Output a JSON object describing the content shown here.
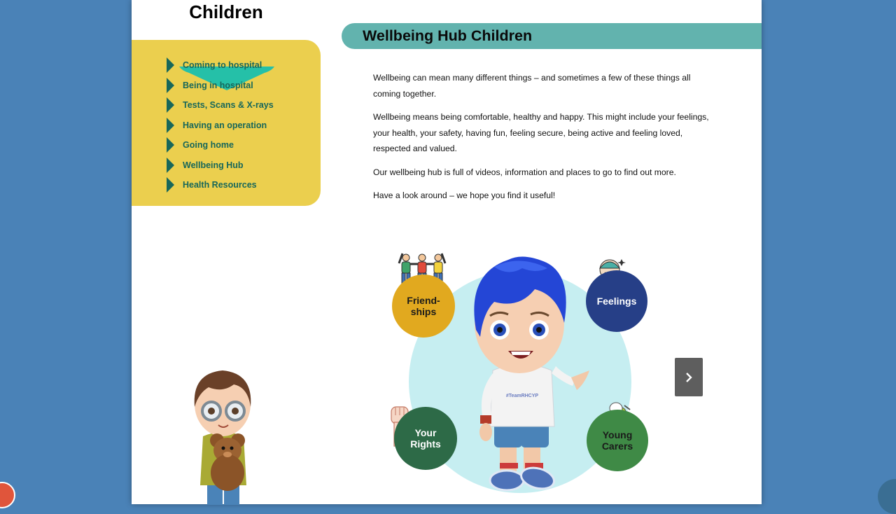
{
  "nav": {
    "heading": "Children",
    "items": [
      {
        "label": "Coming to hospital"
      },
      {
        "label": "Being in hospital"
      },
      {
        "label": "Tests, Scans & X-rays"
      },
      {
        "label": "Having an operation"
      },
      {
        "label": "Going home"
      },
      {
        "label": "Wellbeing Hub"
      },
      {
        "label": "Health Resources"
      }
    ]
  },
  "main": {
    "title": "Wellbeing Hub Children",
    "paragraphs": [
      "Wellbeing can mean many different things – and sometimes a few of these things all coming together.",
      "Wellbeing means being comfortable, healthy and happy.  This might include your feelings, your health, your safety, having fun, feeling secure, being active and feeling loved, respected and valued.",
      "Our wellbeing hub is full of videos, information and places to go to find out more.",
      "Have a look around – we hope you find it useful!"
    ]
  },
  "wheel": {
    "topics": [
      {
        "line1": "Friend-",
        "line2": "ships"
      },
      {
        "line1": "Feelings",
        "line2": ""
      },
      {
        "line1": "Your",
        "line2": "Rights"
      },
      {
        "line1": "Young",
        "line2": "Carers"
      }
    ],
    "shirt_text": "#TeamRHCYP"
  },
  "colors": {
    "page_background": "#4a82b7",
    "nav_panel": "#ebcf4e",
    "nav_text": "#17675a",
    "title_bar": "#62b3ae"
  },
  "icons": {
    "nav_bullet": "triangle-right",
    "next": "chevron-right"
  }
}
